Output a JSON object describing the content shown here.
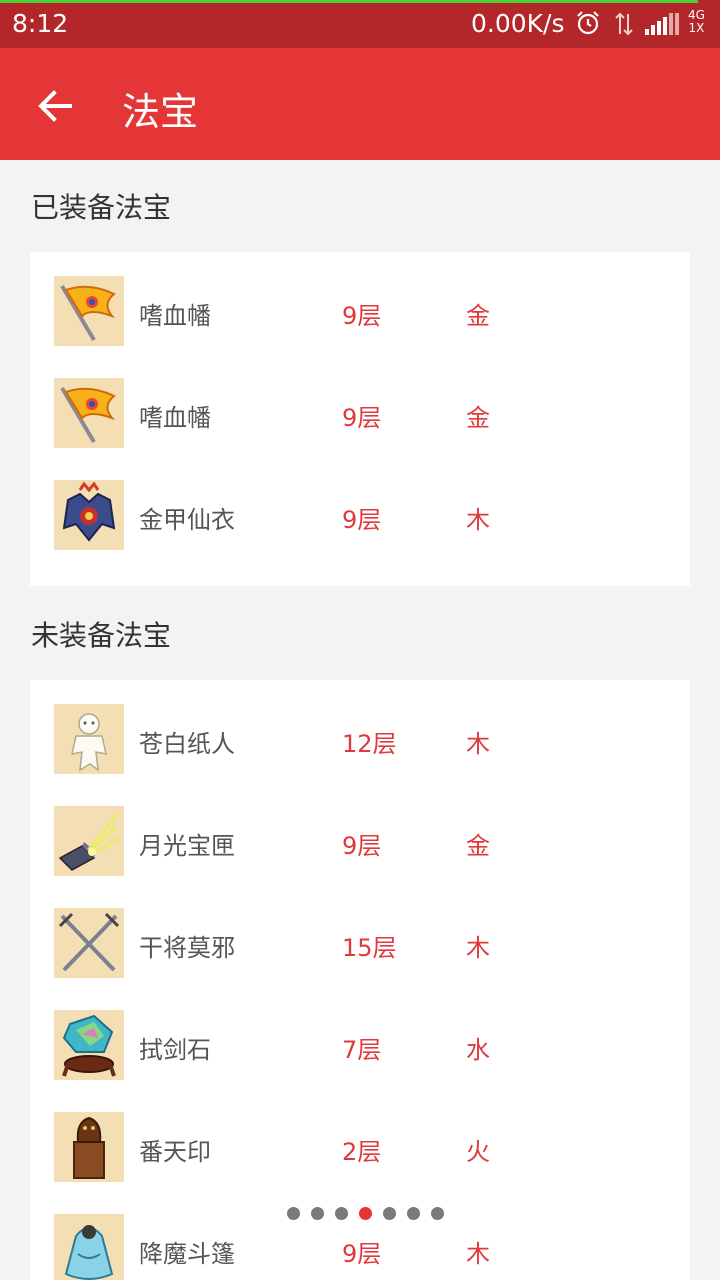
{
  "status_bar": {
    "time": "8:12",
    "speed": "0.00K/s",
    "network_top": "4G",
    "network_bottom": "1X"
  },
  "app_bar": {
    "title": "法宝"
  },
  "equipped": {
    "title": "已装备法宝",
    "items": [
      {
        "name": "嗜血幡",
        "level": "9层",
        "element": "金",
        "icon": "banner-icon"
      },
      {
        "name": "嗜血幡",
        "level": "9层",
        "element": "金",
        "icon": "banner-icon"
      },
      {
        "name": "金甲仙衣",
        "level": "9层",
        "element": "木",
        "icon": "armor-icon"
      }
    ]
  },
  "unequipped": {
    "title": "未装备法宝",
    "items": [
      {
        "name": "苍白纸人",
        "level": "12层",
        "element": "木",
        "icon": "paper-doll-icon"
      },
      {
        "name": "月光宝匣",
        "level": "9层",
        "element": "金",
        "icon": "treasure-box-icon"
      },
      {
        "name": "干将莫邪",
        "level": "15层",
        "element": "木",
        "icon": "crossed-swords-icon"
      },
      {
        "name": "拭剑石",
        "level": "7层",
        "element": "水",
        "icon": "gem-stone-icon"
      },
      {
        "name": "番天印",
        "level": "2层",
        "element": "火",
        "icon": "seal-icon"
      },
      {
        "name": "降魔斗篷",
        "level": "9层",
        "element": "木",
        "icon": "cloak-icon"
      }
    ]
  },
  "pager": {
    "count": 7,
    "active_index": 3
  },
  "colors": {
    "status_bar": "#b3272a",
    "app_bar": "#e53637",
    "accent_text": "#e0393c",
    "thumb_bg": "#f4dfb5"
  }
}
